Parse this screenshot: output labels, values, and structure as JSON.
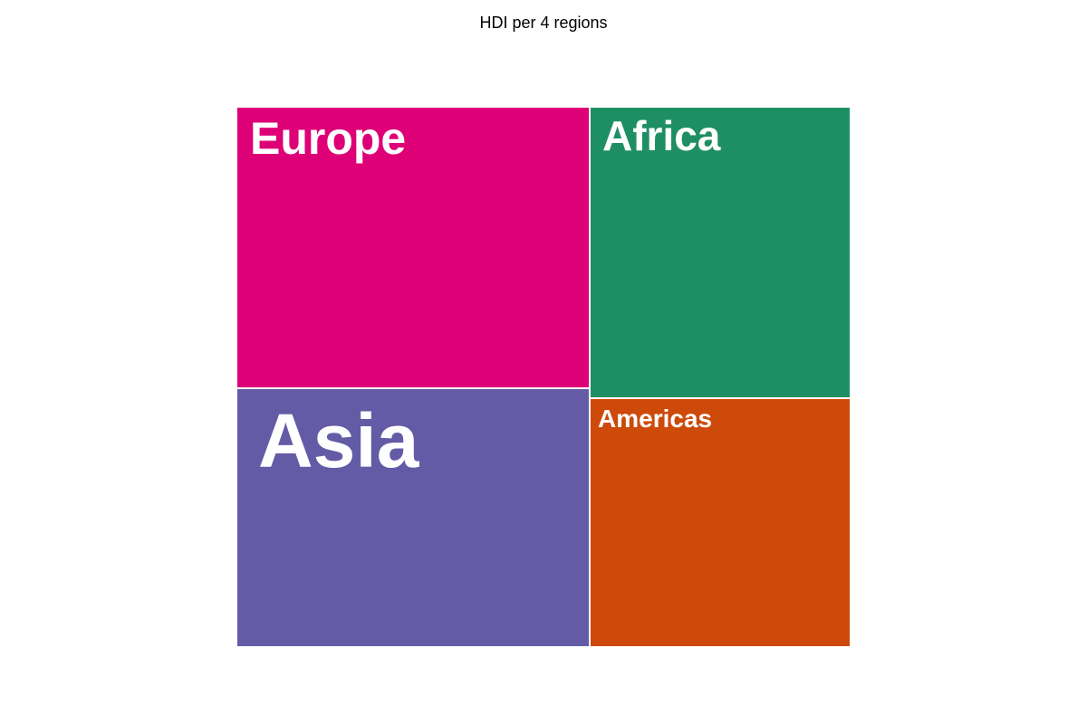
{
  "chart_data": {
    "type": "treemap",
    "title": "HDI per 4 regions",
    "regions": [
      {
        "name": "Europe",
        "color": "#dd0077"
      },
      {
        "name": "Africa",
        "color": "#1e8f65"
      },
      {
        "name": "Asia",
        "color": "#635ba6"
      },
      {
        "name": "Americas",
        "color": "#cd4a0b"
      }
    ]
  }
}
